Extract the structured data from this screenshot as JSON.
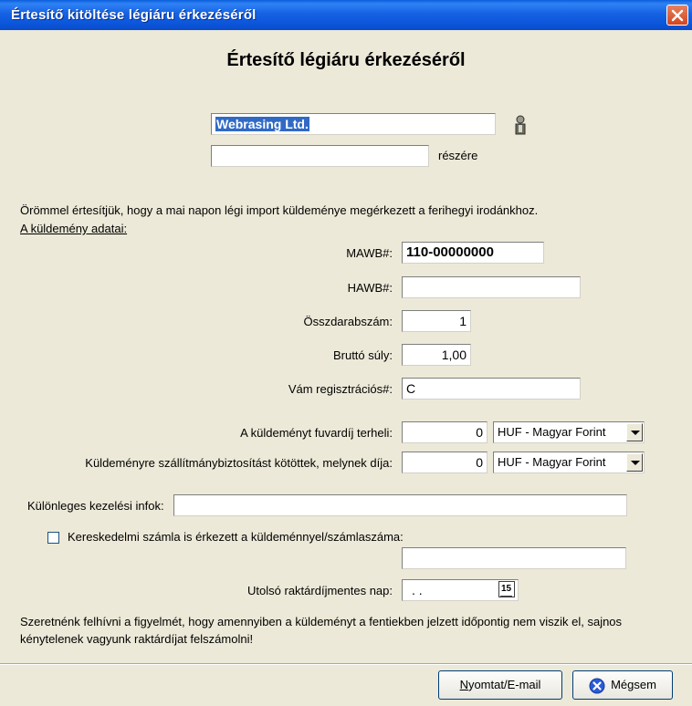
{
  "window": {
    "title": "Értesítő kitöltése légiáru érkezéséről"
  },
  "form": {
    "heading": "Értesítő légiáru érkezéséről",
    "recipient_name": "Webrasing Ltd.",
    "recipient_extra": "",
    "recipient_suffix": "részére",
    "intro": "Örömmel értesítjük, hogy a mai napon légi import küldeménye megérkezett a ferihegyi irodánkhoz.",
    "section_title": "A küldemény adatai:",
    "mawb_label": "MAWB#:",
    "mawb_value": "110-00000000",
    "hawb_label": "HAWB#:",
    "hawb_value": "",
    "pieces_label": "Összdarabszám:",
    "pieces_value": "1",
    "weight_label": "Bruttó súly:",
    "weight_value": "1,00",
    "customs_label": "Vám regisztrációs#:",
    "customs_value": "C",
    "freight_label": "A küldeményt fuvardíj terheli:",
    "freight_value": "0",
    "freight_currency": "HUF - Magyar Forint",
    "insurance_label": "Küldeményre szállítmánybiztosítást kötöttek, melynek díja:",
    "insurance_value": "0",
    "insurance_currency": "HUF - Magyar Forint",
    "handling_label": "Különleges kezelési infok:",
    "handling_value": "",
    "invoice_checkbox_label": "Kereskedelmi számla is érkezett a küldeménnyel/számlaszáma:",
    "invoice_checked": false,
    "invoice_value": "",
    "last_free_day_label": "Utolsó raktárdíjmentes nap:",
    "last_free_day_value": " .  .",
    "calendar_icon_text": "15",
    "notice": "Szeretnénk felhívni a figyelmét, hogy amennyiben a küldeményt a fentiekben jelzett időpontig nem viszik el, sajnos kénytelenek vagyunk raktárdíjat felszámolni!"
  },
  "buttons": {
    "print_label": "Nyomtat/E-mail",
    "print_accel": "N",
    "print_rest": "yomtat/E-mail",
    "cancel_label": "Mégsem"
  }
}
